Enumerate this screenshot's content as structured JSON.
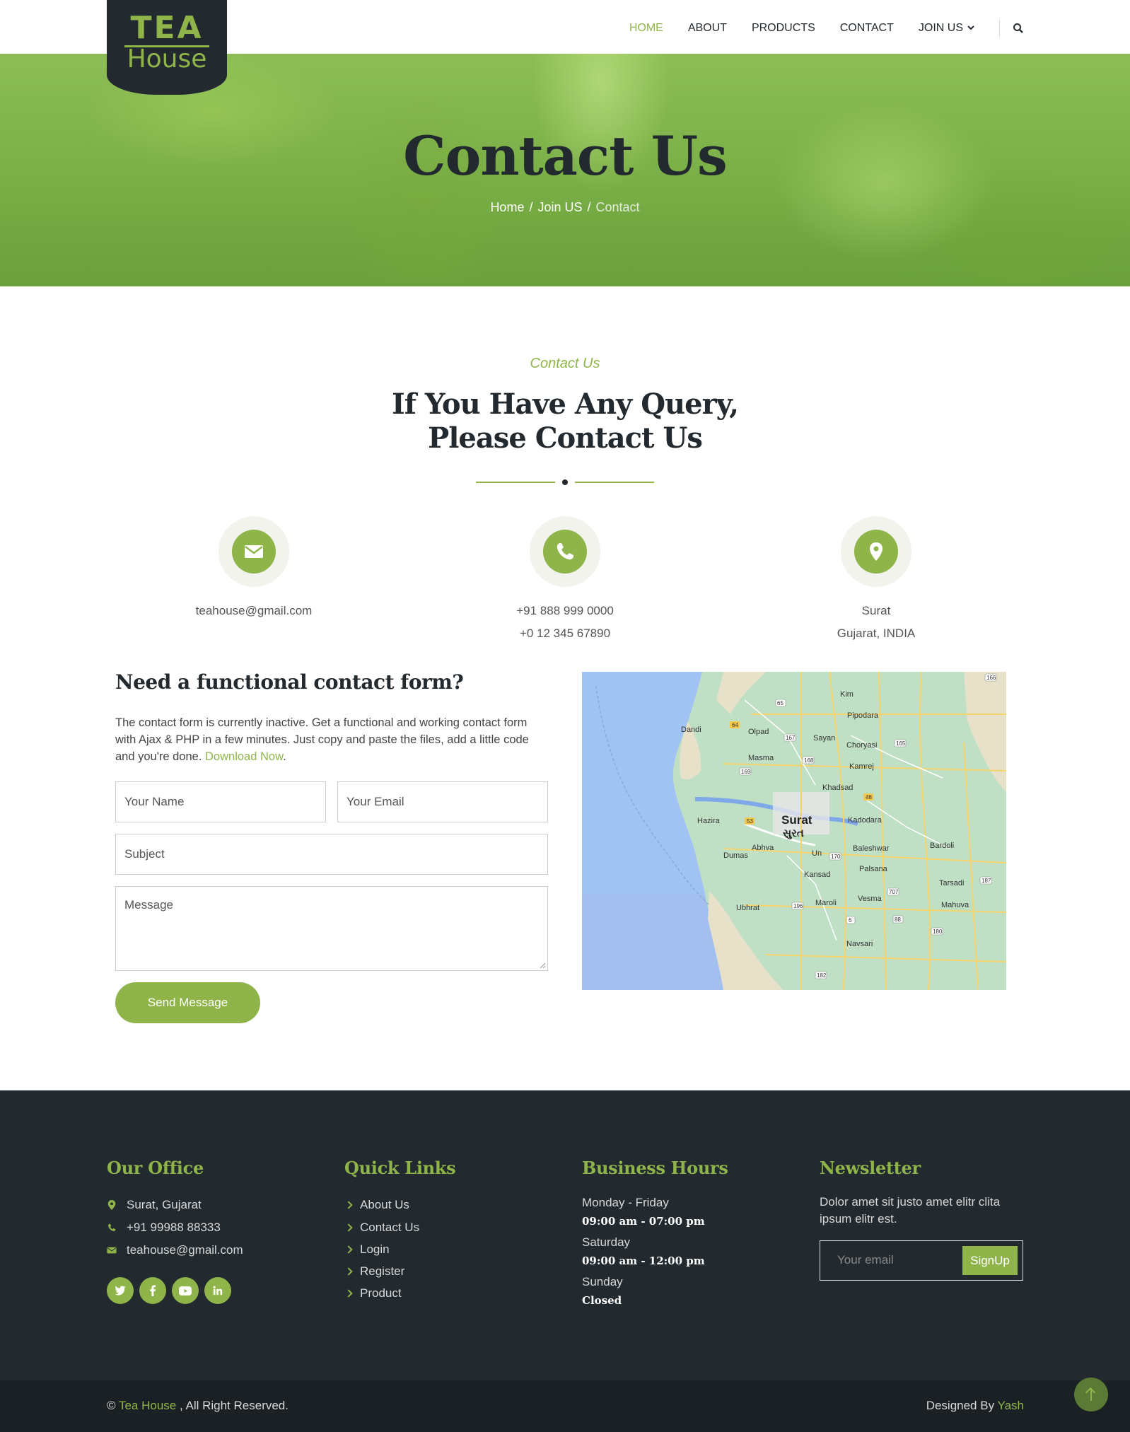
{
  "brand": {
    "line1": "TEA",
    "line2": "House"
  },
  "nav": {
    "items": [
      "HOME",
      "ABOUT",
      "PRODUCTS",
      "CONTACT",
      "JOIN US"
    ],
    "active": "HOME"
  },
  "hero": {
    "title": "Contact Us",
    "breadcrumb": [
      "Home",
      "Join US",
      "Contact"
    ],
    "separator": "/"
  },
  "contact": {
    "subtitle": "Contact Us",
    "title_line1": "If You Have Any Query,",
    "title_line2": "Please Contact Us",
    "email": "teahouse@gmail.com",
    "phone1": "+91 888 999 0000",
    "phone2": "+0 12 345 67890",
    "city": "Surat",
    "region": "Gujarat, INDIA"
  },
  "form": {
    "heading": "Need a functional contact form?",
    "text": "The contact form is currently inactive. Get a functional and working contact form with Ajax & PHP in a few minutes. Just copy and paste the files, add a little code and you're done.",
    "link_text": "Download Now",
    "after_link": ".",
    "name_placeholder": "Your Name",
    "email_placeholder": "Your Email",
    "subject_placeholder": "Subject",
    "message_placeholder": "Message",
    "button": "Send Message"
  },
  "map": {
    "labels": [
      "Surat",
      "સુરત",
      "Kim",
      "Olpad",
      "Dandi",
      "Sayan",
      "Masma",
      "Choryasi",
      "Kamrej",
      "Pipodara",
      "Khadsad",
      "Hazira",
      "Kadodara",
      "Abhva",
      "Dumas",
      "Baleshwar",
      "Bardoli",
      "Palsana",
      "Kansad",
      "Un",
      "Tarsadi",
      "Vesma",
      "Maroli",
      "Ubhrat",
      "Mahuva",
      "Navsari"
    ],
    "highway_numbers": [
      "64",
      "65",
      "168",
      "167",
      "169",
      "165",
      "166",
      "53",
      "48",
      "170",
      "196",
      "6",
      "88",
      "180",
      "707",
      "187",
      "182"
    ]
  },
  "footer": {
    "office": {
      "title": "Our Office",
      "address": "Surat, Gujarat",
      "phone": "+91 99988 88333",
      "email": "teahouse@gmail.com"
    },
    "quick_links": {
      "title": "Quick Links",
      "items": [
        "About Us",
        "Contact Us",
        "Login",
        "Register",
        "Product"
      ]
    },
    "hours": {
      "title": "Business Hours",
      "d1": "Monday - Friday",
      "t1": "09:00 am - 07:00 pm",
      "d2": "Saturday",
      "t2": "09:00 am - 12:00 pm",
      "d3": "Sunday",
      "t3": "Closed"
    },
    "newsletter": {
      "title": "Newsletter",
      "text": "Dolor amet sit justo amet elitr clita ipsum elitr est.",
      "placeholder": "Your email",
      "button": "SignUp"
    }
  },
  "copyright": {
    "symbol": "©",
    "brand": "Tea House",
    "rest": ", All Right Reserved.",
    "designed_by": "Designed By",
    "designer": "Yash"
  },
  "colors": {
    "accent": "#8fb54a",
    "dark": "#232a2f"
  }
}
